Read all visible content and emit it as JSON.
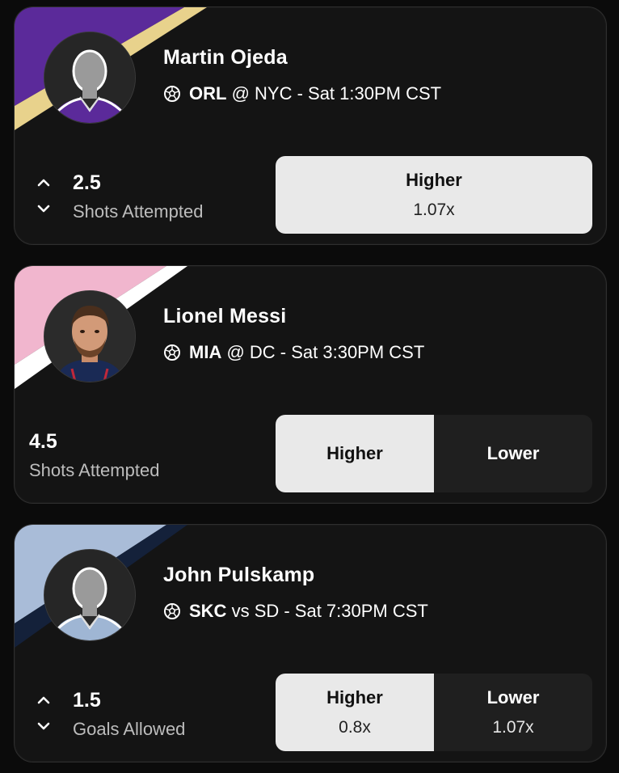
{
  "cards": [
    {
      "player": "Martin Ojeda",
      "team": "ORL",
      "matchup_rest": "@ NYC - Sat 1:30PM CST",
      "stat_value": "2.5",
      "stat_label": "Shots Attempted",
      "higher_label": "Higher",
      "higher_mult": "1.07x",
      "colors": {
        "primary": "#5b2a9a",
        "secondary": "#e8d28c"
      }
    },
    {
      "player": "Lionel Messi",
      "team": "MIA",
      "matchup_rest": "@ DC - Sat 3:30PM CST",
      "stat_value": "4.5",
      "stat_label": "Shots Attempted",
      "higher_label": "Higher",
      "lower_label": "Lower",
      "colors": {
        "primary": "#f1b6ce",
        "secondary": "#ffffff"
      }
    },
    {
      "player": "John Pulskamp",
      "team": "SKC",
      "matchup_rest": "vs SD - Sat 7:30PM CST",
      "stat_value": "1.5",
      "stat_label": "Goals Allowed",
      "higher_label": "Higher",
      "higher_mult": "0.8x",
      "lower_label": "Lower",
      "lower_mult": "1.07x",
      "colors": {
        "primary": "#a9bcd8",
        "secondary": "#14213a"
      }
    }
  ]
}
